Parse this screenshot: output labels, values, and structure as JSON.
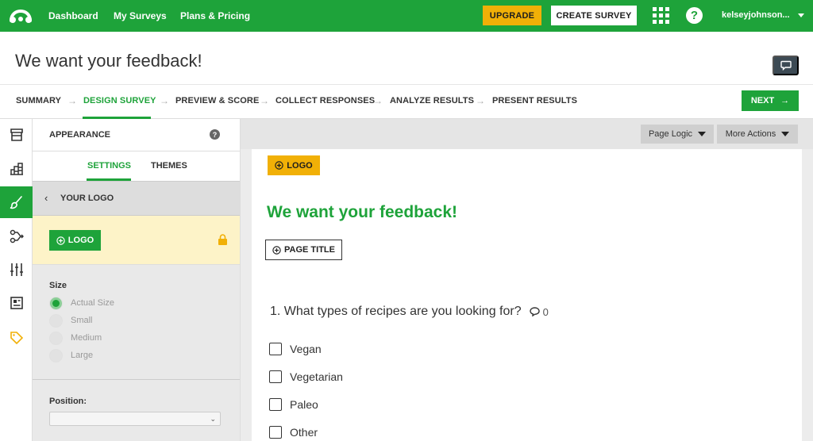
{
  "topnav": {
    "links": [
      "Dashboard",
      "My Surveys",
      "Plans & Pricing"
    ],
    "upgrade_label": "UPGRADE",
    "create_label": "CREATE SURVEY",
    "help_glyph": "?",
    "username": "kelseyjohnson...",
    "colors": {
      "brand": "#1ea33a",
      "upgrade": "#f1b007"
    }
  },
  "survey": {
    "title": "We want your feedback!",
    "comment_icon": "comment-icon"
  },
  "steps": {
    "items": [
      "SUMMARY",
      "DESIGN SURVEY",
      "PREVIEW & SCORE",
      "COLLECT RESPONSES",
      "ANALYZE RESULTS",
      "PRESENT RESULTS"
    ],
    "active": "DESIGN SURVEY",
    "next_label": "NEXT"
  },
  "rail": {
    "icons": [
      "store-icon",
      "question-bank-icon",
      "paintbrush-icon",
      "logic-icon",
      "options-sliders-icon",
      "layout-icon",
      "tag-icon"
    ],
    "active": "paintbrush-icon"
  },
  "panel": {
    "title": "APPEARANCE",
    "help_glyph": "?",
    "tabs": [
      "SETTINGS",
      "THEMES"
    ],
    "active_tab": "SETTINGS",
    "section_title": "YOUR LOGO",
    "logo_button": "LOGO",
    "size_label": "Size",
    "size_options": [
      "Actual Size",
      "Small",
      "Medium",
      "Large"
    ],
    "size_selected": "Actual Size",
    "position_label": "Position:",
    "position_value": ""
  },
  "canvas": {
    "page_logic_label": "Page Logic",
    "more_actions_label": "More Actions",
    "logo_button": "LOGO",
    "page_heading": "We want your feedback!",
    "page_title_button": "PAGE TITLE",
    "question": "1. What types of recipes are you looking for?",
    "question_comment_count": "0",
    "options": [
      "Vegan",
      "Vegetarian",
      "Paleo",
      "Other"
    ]
  }
}
